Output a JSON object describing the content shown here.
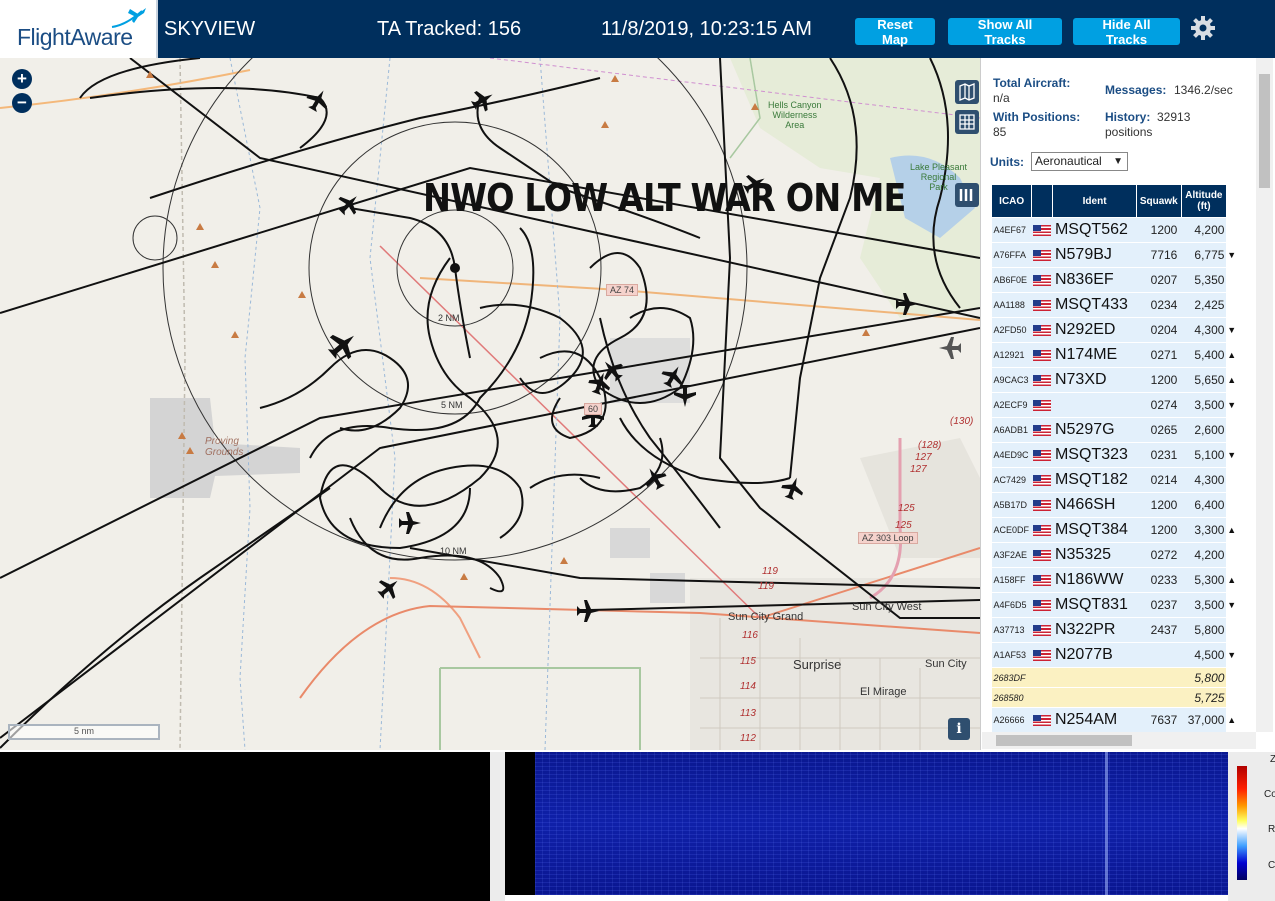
{
  "header": {
    "logo_text": "FlightAware",
    "app_title": "SKYVIEW",
    "tracked_label": "TA Tracked: 156",
    "datetime": "11/8/2019, 10:23:15 AM",
    "buttons": {
      "reset_map": "Reset Map",
      "show_all": "Show All Tracks",
      "hide_all": "Hide All Tracks"
    },
    "brand_color": "#002f5d",
    "button_color": "#00a0e2"
  },
  "map": {
    "zoom_in": "+",
    "zoom_out": "−",
    "overlay_text": "NWO LOW ALT WAR ON ME",
    "scale_label": "5 nm",
    "info_label": "i",
    "range_rings": [
      "2 NM",
      "5 NM",
      "10 NM"
    ],
    "places": {
      "hells_canyon": "Hells Canyon\nWilderness\nArea",
      "lake_pleasant": "Lake Pleasant\nRegional\nPark",
      "proving_grounds": "Proving\nGrounds",
      "sun_city_grand": "Sun City Grand",
      "sun_city_west": "Sun City West",
      "surprise": "Surprise",
      "sun_city": "Sun City",
      "el_mirage": "El Mirage"
    },
    "roads": {
      "az74": "AZ 74",
      "az303": "AZ 303 Loop",
      "us60": "60"
    },
    "route_numbers": [
      "(130)",
      "(128)",
      "127",
      "127",
      "125",
      "125",
      "119",
      "119",
      "116",
      "115",
      "114",
      "113",
      "112"
    ]
  },
  "stats": {
    "total_aircraft_label": "Total Aircraft:",
    "total_aircraft_value": "n/a",
    "messages_label": "Messages:",
    "messages_value": "1346.2/sec",
    "with_positions_label": "With Positions:",
    "with_positions_value": "85",
    "history_label": "History:",
    "history_value": "32913",
    "history_unit": "positions",
    "units_label": "Units:",
    "units_value": "Aeronautical"
  },
  "table": {
    "headers": {
      "icao": "ICAO",
      "ident": "Ident",
      "squawk": "Squawk",
      "altitude": "Altitude",
      "altitude_unit": "(ft)"
    },
    "rows": [
      {
        "icao": "A4EF67",
        "ident": "MSQT562",
        "squawk": "1200",
        "alt": "4,200",
        "trend": ""
      },
      {
        "icao": "A76FFA",
        "ident": "N579BJ",
        "squawk": "7716",
        "alt": "6,775",
        "trend": "▼"
      },
      {
        "icao": "AB6F0E",
        "ident": "N836EF",
        "squawk": "0207",
        "alt": "5,350",
        "trend": ""
      },
      {
        "icao": "AA1188",
        "ident": "MSQT433",
        "squawk": "0234",
        "alt": "2,425",
        "trend": ""
      },
      {
        "icao": "A2FD50",
        "ident": "N292ED",
        "squawk": "0204",
        "alt": "4,300",
        "trend": "▼"
      },
      {
        "icao": "A12921",
        "ident": "N174ME",
        "squawk": "0271",
        "alt": "5,400",
        "trend": "▲"
      },
      {
        "icao": "A9CAC3",
        "ident": "N73XD",
        "squawk": "1200",
        "alt": "5,650",
        "trend": "▲"
      },
      {
        "icao": "A2ECF9",
        "ident": "",
        "squawk": "0274",
        "alt": "3,500",
        "trend": "▼"
      },
      {
        "icao": "A6ADB1",
        "ident": "N5297G",
        "squawk": "0265",
        "alt": "2,600",
        "trend": ""
      },
      {
        "icao": "A4ED9C",
        "ident": "MSQT323",
        "squawk": "0231",
        "alt": "5,100",
        "trend": "▼"
      },
      {
        "icao": "AC7429",
        "ident": "MSQT182",
        "squawk": "0214",
        "alt": "4,300",
        "trend": ""
      },
      {
        "icao": "A5B17D",
        "ident": "N466SH",
        "squawk": "1200",
        "alt": "6,400",
        "trend": ""
      },
      {
        "icao": "ACE0DF",
        "ident": "MSQT384",
        "squawk": "1200",
        "alt": "3,300",
        "trend": "▲"
      },
      {
        "icao": "A3F2AE",
        "ident": "N35325",
        "squawk": "0272",
        "alt": "4,200",
        "trend": ""
      },
      {
        "icao": "A158FF",
        "ident": "N186WW",
        "squawk": "0233",
        "alt": "5,300",
        "trend": "▲"
      },
      {
        "icao": "A4F6D5",
        "ident": "MSQT831",
        "squawk": "0237",
        "alt": "3,500",
        "trend": "▼"
      },
      {
        "icao": "A37713",
        "ident": "N322PR",
        "squawk": "2437",
        "alt": "5,800",
        "trend": ""
      },
      {
        "icao": "A1AF53",
        "ident": "N2077B",
        "squawk": "",
        "alt": "4,500",
        "trend": "▼"
      },
      {
        "icao": "2683DF",
        "ident": "",
        "squawk": "",
        "alt": "5,800",
        "trend": "",
        "highlight": true
      },
      {
        "icao": "268580",
        "ident": "",
        "squawk": "",
        "alt": "5,725",
        "trend": "",
        "highlight": true
      },
      {
        "icao": "A26666",
        "ident": "N254AM",
        "squawk": "7637",
        "alt": "37,000",
        "trend": "▲"
      }
    ]
  },
  "bottom_right": {
    "labels": [
      "Z",
      "Co",
      "R",
      "C"
    ]
  }
}
